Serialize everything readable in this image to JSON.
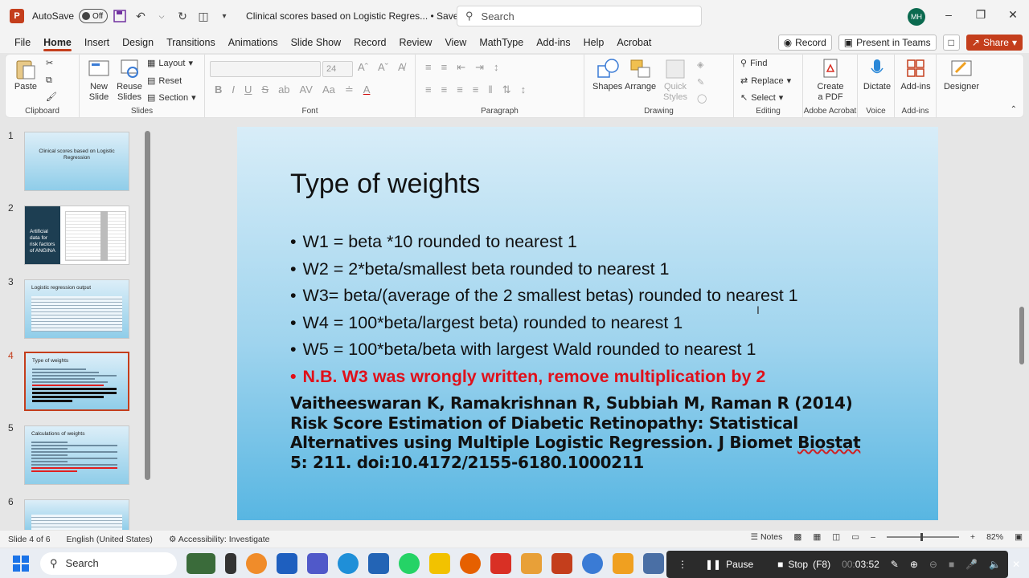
{
  "titlebar": {
    "autosave_label": "AutoSave",
    "autosave_state": "Off",
    "doc_title": "Clinical scores based on Logistic Regres... • Saved to this PC",
    "search_placeholder": "Search",
    "user_initials": "MH"
  },
  "menu": {
    "tabs": [
      "File",
      "Home",
      "Insert",
      "Design",
      "Transitions",
      "Animations",
      "Slide Show",
      "Record",
      "Review",
      "View",
      "MathType",
      "Add-ins",
      "Help",
      "Acrobat"
    ],
    "active": "Home",
    "record_btn": "Record",
    "present_btn": "Present in Teams",
    "share_btn": "Share"
  },
  "ribbon": {
    "clipboard": {
      "paste": "Paste",
      "label": "Clipboard"
    },
    "slides": {
      "new_slide": "New Slide",
      "reuse_slides": "Reuse Slides",
      "layout": "Layout",
      "reset": "Reset",
      "section": "Section",
      "label": "Slides"
    },
    "font": {
      "size": "24",
      "label": "Font"
    },
    "paragraph": {
      "label": "Paragraph"
    },
    "drawing": {
      "shapes": "Shapes",
      "arrange": "Arrange",
      "quick_styles": "Quick Styles",
      "label": "Drawing"
    },
    "editing": {
      "find": "Find",
      "replace": "Replace",
      "select": "Select",
      "label": "Editing"
    },
    "acrobat": {
      "create_pdf": "Create a PDF",
      "label": "Adobe Acrobat"
    },
    "voice": {
      "dictate": "Dictate",
      "label": "Voice"
    },
    "addins": {
      "addins": "Add-ins",
      "label": "Add-ins"
    },
    "designer": {
      "designer": "Designer"
    }
  },
  "thumbnails": [
    {
      "num": "1",
      "title": "Clinical scores based on Logistic Regression"
    },
    {
      "num": "2",
      "title": "Artificial data for risk factors of ANGINA"
    },
    {
      "num": "3",
      "title": "Logistic regression output"
    },
    {
      "num": "4",
      "title": "Type of weights",
      "selected": true
    },
    {
      "num": "5",
      "title": "Calculations of weights"
    },
    {
      "num": "6",
      "title": ""
    }
  ],
  "slide": {
    "title": "Type of weights",
    "bullets": [
      "W1 = beta *10 rounded to nearest 1",
      "W2 = 2*beta/smallest beta rounded to nearest 1",
      "W3= beta/(average of the 2 smallest betas) rounded to nearest 1",
      "W4 = 100*beta/largest beta) rounded to nearest 1",
      "W5 = 100*beta/beta with largest Wald rounded to nearest 1"
    ],
    "note": "N.B. W3 was wrongly written, remove multiplication by 2",
    "citation_a": "Vaitheeswaran K, Ramakrishnan R, Subbiah M, Raman R (2014) Risk Score Estimation of Diabetic Retinopathy: Statistical Alternatives using Multiple Logistic Regression. J Biomet ",
    "citation_sq": "Biostat",
    "citation_b": " 5: 211. doi:10.4172/2155-6180.1000211"
  },
  "statusbar": {
    "slide_info": "Slide 4 of 6",
    "language": "English (United States)",
    "accessibility": "Accessibility: Investigate",
    "notes": "Notes",
    "zoom": "82%"
  },
  "taskbar": {
    "search": "Search"
  },
  "recorder": {
    "pause": "Pause",
    "stop": "Stop",
    "stop_key": "(F8)",
    "time_prefix": "00:",
    "time": "03:52"
  },
  "colors": {
    "accent": "#c43e1c",
    "note_red": "#e0101a"
  }
}
